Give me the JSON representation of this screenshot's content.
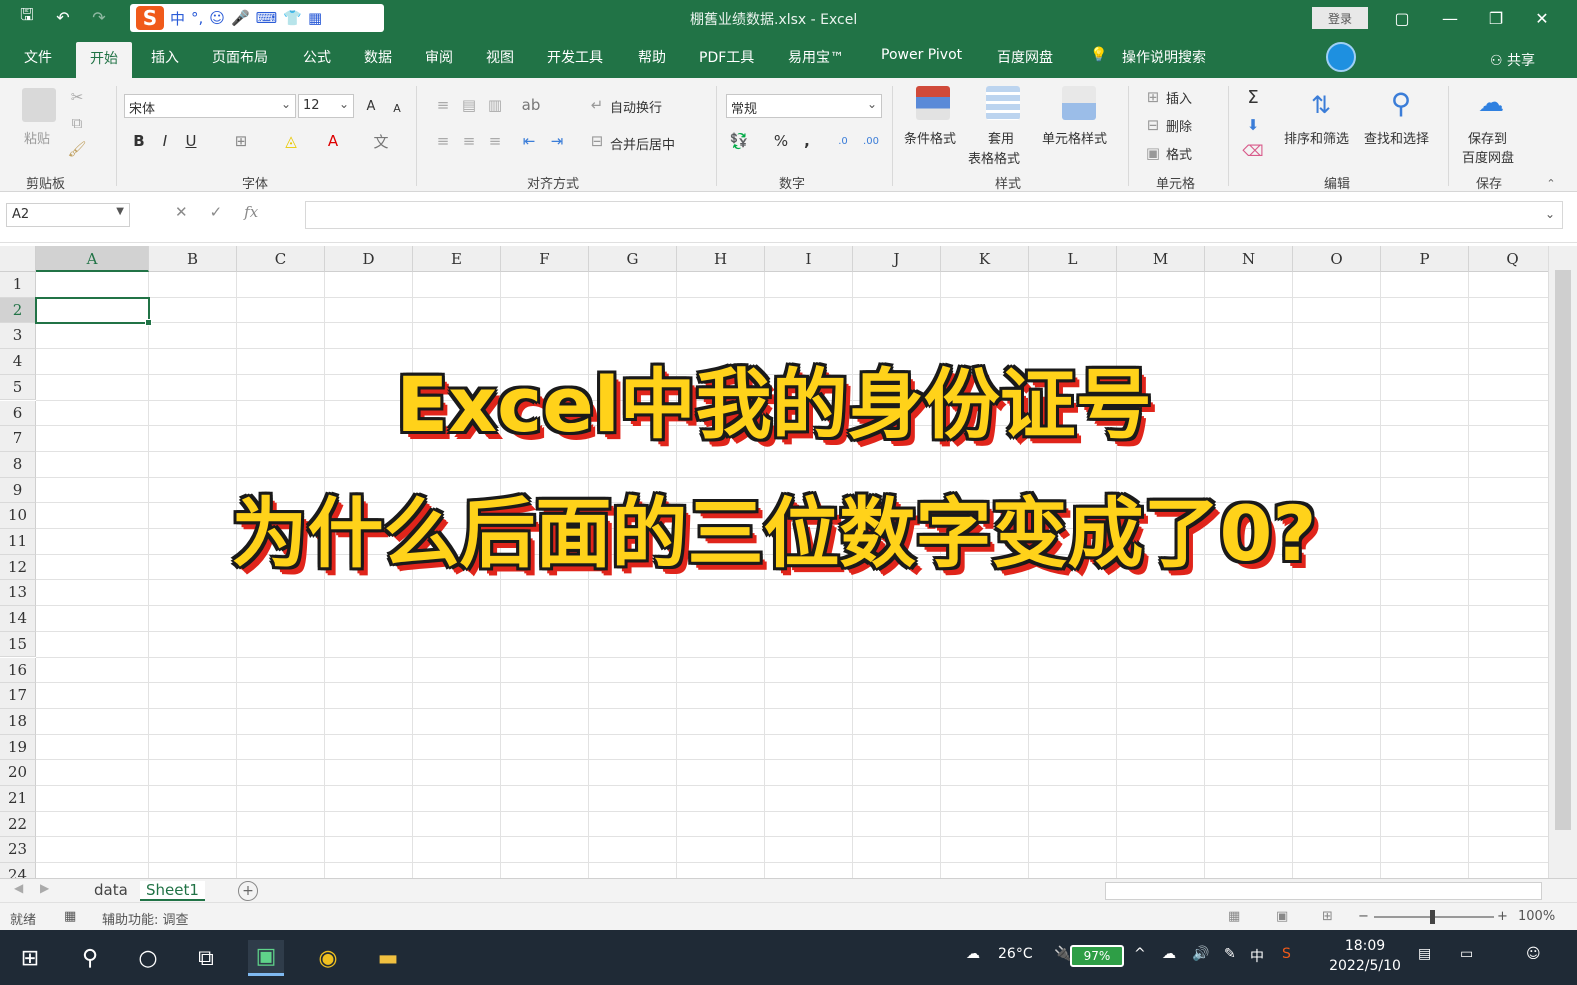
{
  "window": {
    "title": "棚舊业绩数据.xlsx - Excel",
    "signin": "登录",
    "controls": [
      "▢",
      "—",
      "❐",
      "✕"
    ]
  },
  "ime": {
    "logo": "S",
    "items": [
      "中",
      "°,",
      "☺",
      "🎤",
      "⌨",
      "👕",
      "▦"
    ]
  },
  "tabs": [
    {
      "label": "文件"
    },
    {
      "label": "开始"
    },
    {
      "label": "插入"
    },
    {
      "label": "页面布局"
    },
    {
      "label": "公式"
    },
    {
      "label": "数据"
    },
    {
      "label": "审阅"
    },
    {
      "label": "视图"
    },
    {
      "label": "开发工具"
    },
    {
      "label": "帮助"
    },
    {
      "label": "PDF工具"
    },
    {
      "label": "易用宝™"
    },
    {
      "label": "Power Pivot"
    },
    {
      "label": "百度网盘"
    },
    {
      "label": "操作说明搜索"
    }
  ],
  "share": "共享",
  "ribbon": {
    "clipboard": {
      "label": "剪贴板",
      "paste": "粘贴"
    },
    "font": {
      "label": "字体",
      "name": "宋体",
      "size": "12",
      "bold": "B",
      "italic": "I",
      "underline": "U",
      "grow": "A",
      "shrink": "A"
    },
    "alignment": {
      "label": "对齐方式",
      "wrap": "自动换行",
      "merge": "合并后居中"
    },
    "number": {
      "label": "数字",
      "format": "常规",
      "percent": "%",
      "comma": ","
    },
    "styles": {
      "label": "样式",
      "conditional": "条件格式",
      "table_line1": "套用",
      "table_line2": "表格格式",
      "cell_styles": "单元格样式"
    },
    "cells": {
      "label": "单元格",
      "insert": "插入",
      "delete": "删除",
      "format": "格式"
    },
    "editing": {
      "label": "编辑",
      "sum": "Σ",
      "sort": "排序和筛选",
      "find": "查找和选择"
    },
    "save": {
      "label": "保存",
      "line1": "保存到",
      "line2": "百度网盘"
    }
  },
  "formula_bar": {
    "name_box": "A2",
    "cancel": "✕",
    "enter": "✓",
    "fx": "fx",
    "value": ""
  },
  "grid": {
    "columns": [
      "A",
      "B",
      "C",
      "D",
      "E",
      "F",
      "G",
      "H",
      "I",
      "J",
      "K",
      "L",
      "M",
      "N",
      "O",
      "P",
      "Q"
    ],
    "rows": [
      "1",
      "2",
      "3",
      "4",
      "5",
      "6",
      "7",
      "8",
      "9",
      "10",
      "11",
      "12",
      "13",
      "14",
      "15",
      "16",
      "17",
      "18",
      "19",
      "20",
      "21",
      "22",
      "23",
      "24"
    ],
    "active_cell": "A2"
  },
  "caption": {
    "line1": "Excel中我的身份证号",
    "line2": "为什么后面的三位数字变成了0?"
  },
  "sheets": [
    {
      "label": "data"
    },
    {
      "label": "Sheet1"
    }
  ],
  "status": {
    "ready": "就绪",
    "accessibility": "辅助功能: 调查",
    "zoom": "100%"
  },
  "taskbar": {
    "weather": "26°C",
    "battery": "97%",
    "ime": "中",
    "time": "18:09",
    "date": "2022/5/10"
  },
  "colors": {
    "excel_green": "#217346",
    "caption_fill": "#ffd21a",
    "caption_shadow": "#e0251b"
  }
}
